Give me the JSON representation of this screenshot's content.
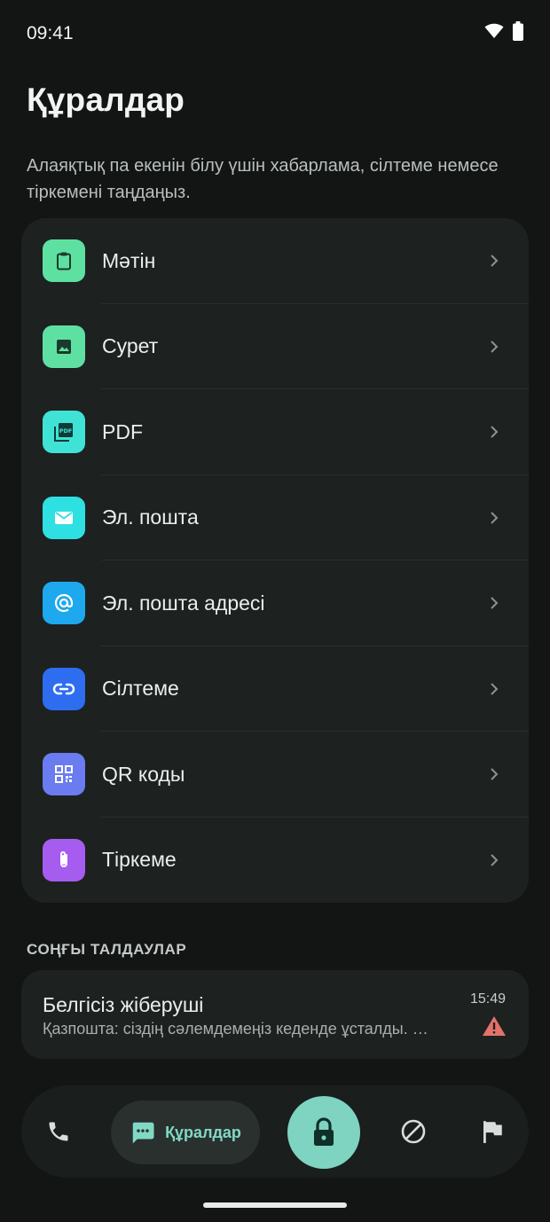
{
  "status": {
    "time": "09:41"
  },
  "header": {
    "title": "Құралдар",
    "subtitle": "Алаяқтық па екенін білу үшін хабарлама, сілтеме немесе тіркемені таңдаңыз."
  },
  "tools": [
    {
      "label": "Мәтін",
      "icon": "clipboard-icon",
      "color": "#5ee0a0"
    },
    {
      "label": "Сурет",
      "icon": "image-icon",
      "color": "#5fe0a3"
    },
    {
      "label": "PDF",
      "icon": "pdf-icon",
      "color": "#3fe3d6"
    },
    {
      "label": "Эл. пошта",
      "icon": "mail-icon",
      "color": "#2fe0e3"
    },
    {
      "label": "Эл. пошта адресі",
      "icon": "at-icon",
      "color": "#1ea8ee"
    },
    {
      "label": "Сілтеме",
      "icon": "link-icon",
      "color": "#2f6df0"
    },
    {
      "label": "QR коды",
      "icon": "qr-icon",
      "color": "#6a7cf0"
    },
    {
      "label": "Тіркеме",
      "icon": "paperclip-icon",
      "color": "#a75cf0"
    }
  ],
  "recent": {
    "section_label": "СОҢҒЫ ТАЛДАУЛАР",
    "items": [
      {
        "sender": "Белгісіз жіберуші",
        "preview": "Қазпошта: сіздің сәлемдемеңіз кеденде ұсталды. Төлем жасау үшін сілтемеге өтіңіз",
        "time": "15:49",
        "status_icon": "warning-icon",
        "status_color": "#e2736a"
      }
    ]
  },
  "nav": {
    "items": [
      {
        "name": "calls",
        "icon": "phone-icon"
      },
      {
        "name": "tools",
        "icon": "chat-icon",
        "label": "Құралдар",
        "active": true
      },
      {
        "name": "protect",
        "icon": "lock-icon"
      },
      {
        "name": "blocked",
        "icon": "block-icon"
      },
      {
        "name": "reports",
        "icon": "flag-icon"
      }
    ],
    "active_label": "Құралдар",
    "accent": "#7fd3c1"
  }
}
